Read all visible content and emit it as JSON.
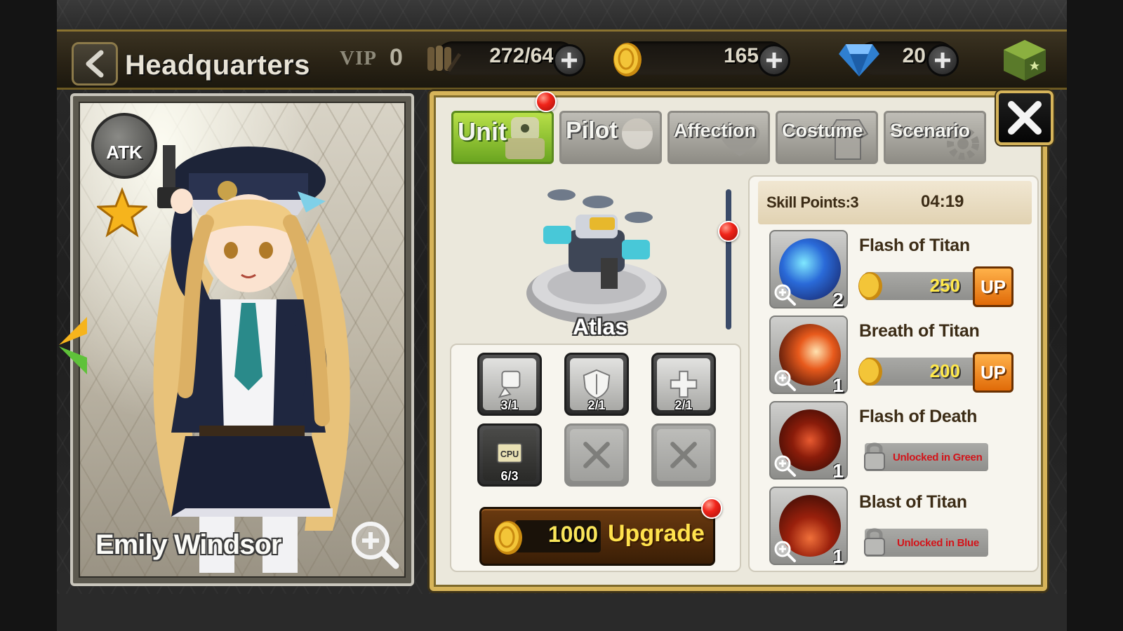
{
  "header": {
    "title": "Headquarters",
    "vip_label": "VIP",
    "vip_level": "0",
    "ammo": "272/64",
    "gold": "165",
    "gems": "20"
  },
  "pilot": {
    "name": "Emily Windsor",
    "class_badge": "ATK",
    "stars": 1
  },
  "tabs": [
    {
      "label": "Unit",
      "active": true
    },
    {
      "label": "Pilot",
      "active": false
    },
    {
      "label": "Affection",
      "active": false
    },
    {
      "label": "Costume",
      "active": false
    },
    {
      "label": "Scenario",
      "active": false
    }
  ],
  "unit": {
    "name": "Atlas",
    "parts": [
      {
        "icon": "rocket-part-icon",
        "count": "3/1"
      },
      {
        "icon": "shield-part-icon",
        "count": "2/1"
      },
      {
        "icon": "repair-cross-icon",
        "count": "2/1"
      },
      {
        "icon": "cpu-chip-icon",
        "count": "6/3"
      },
      {
        "icon": "empty-slot-icon",
        "count": ""
      },
      {
        "icon": "empty-slot-icon",
        "count": ""
      }
    ],
    "upgrade_cost": "1000",
    "upgrade_label": "Upgrade"
  },
  "skills": {
    "points_label": "Skill Points:3",
    "timer": "04:19",
    "list": [
      {
        "name": "Flash of Titan",
        "level": "2",
        "cost": "250",
        "up_label": "UP"
      },
      {
        "name": "Breath of Titan",
        "level": "1",
        "cost": "200",
        "up_label": "UP"
      },
      {
        "name": "Flash of Death",
        "level": "1",
        "locked_text": "Unlocked in Green"
      },
      {
        "name": "Blast of Titan",
        "level": "1",
        "locked_text": "Unlocked in Blue"
      }
    ]
  },
  "colors": {
    "gold_frame": "#d6b45a",
    "active_tab": "#8cc83a",
    "up_button": "#f08a1c",
    "lock_text": "#d3141a",
    "cost_text": "#ffe84a"
  }
}
